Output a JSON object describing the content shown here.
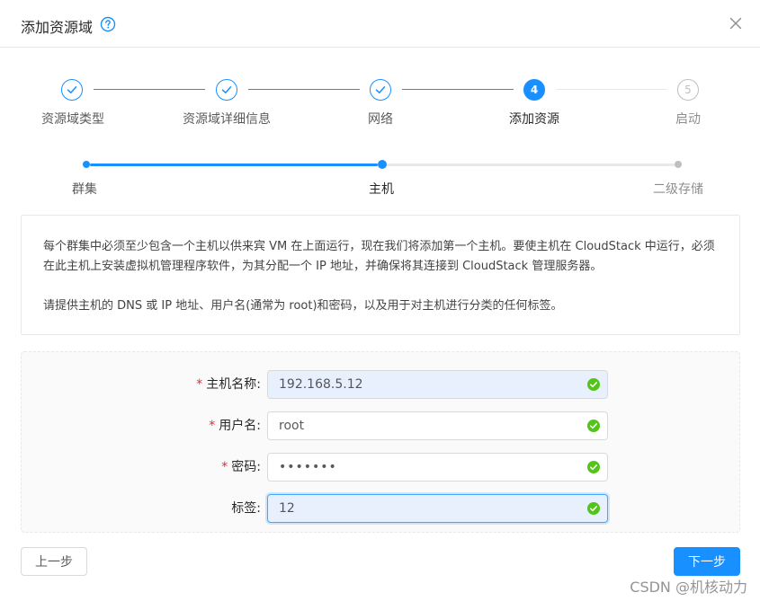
{
  "dialog": {
    "title": "添加资源域",
    "help_icon": "question-circle-icon",
    "close_icon": "close-icon"
  },
  "steps": [
    {
      "label": "资源域类型",
      "status": "done"
    },
    {
      "label": "资源域详细信息",
      "status": "done"
    },
    {
      "label": "网络",
      "status": "done"
    },
    {
      "label": "添加资源",
      "status": "active",
      "number": "4"
    },
    {
      "label": "启动",
      "status": "wait",
      "number": "5"
    }
  ],
  "substeps": [
    {
      "label": "群集",
      "status": "done"
    },
    {
      "label": "主机",
      "status": "active"
    },
    {
      "label": "二级存储",
      "status": "wait"
    }
  ],
  "description": {
    "paragraph1": "每个群集中必须至少包含一个主机以供来宾 VM 在上面运行，现在我们将添加第一个主机。要使主机在 CloudStack 中运行，必须在此主机上安装虚拟机管理程序软件，为其分配一个 IP 地址，并确保将其连接到 CloudStack 管理服务器。",
    "paragraph2": "请提供主机的 DNS 或 IP 地址、用户名(通常为 root)和密码，以及用于对主机进行分类的任何标签。"
  },
  "form": {
    "hostname": {
      "required": true,
      "label": "主机名称:",
      "value": "192.168.5.12"
    },
    "username": {
      "required": true,
      "label": "用户名:",
      "value": "root"
    },
    "password": {
      "required": true,
      "label": "密码:",
      "value": "•••••••"
    },
    "tags": {
      "required": false,
      "label": "标签:",
      "value": "12"
    }
  },
  "buttons": {
    "prev": "上一步",
    "next": "下一步"
  },
  "watermark": "CSDN @机核动力",
  "colors": {
    "primary": "#1890ff",
    "success": "#52c41a",
    "required": "#f5222d"
  }
}
